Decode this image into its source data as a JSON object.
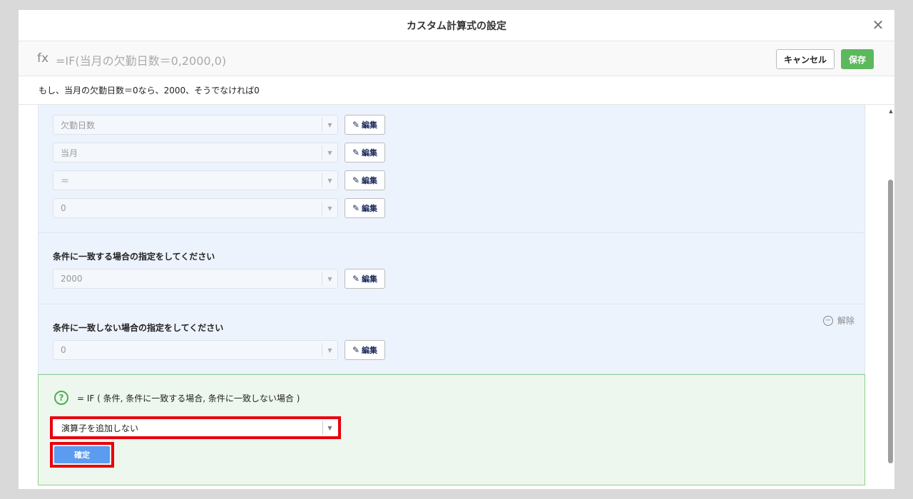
{
  "modal": {
    "title": "カスタム計算式の設定",
    "close_icon": "close-icon"
  },
  "formula_bar": {
    "fx": "fx",
    "formula": "=IF(当月の欠勤日数＝0,2000,0)",
    "cancel_label": "キャンセル",
    "save_label": "保存"
  },
  "description": "もし、当月の欠勤日数＝0なら、2000、そうでなければ0",
  "condition": {
    "rows": [
      {
        "value": "欠勤日数",
        "edit_label": "編集"
      },
      {
        "value": "当月",
        "edit_label": "編集"
      },
      {
        "value": "＝",
        "edit_label": "編集"
      },
      {
        "value": "0",
        "edit_label": "編集"
      }
    ]
  },
  "match": {
    "label": "条件に一致する場合の指定をしてください",
    "value": "2000",
    "edit_label": "編集"
  },
  "nomatch": {
    "label": "条件に一致しない場合の指定をしてください",
    "value": "0",
    "edit_label": "編集",
    "release_label": "解除"
  },
  "help": {
    "syntax": "= IF ( 条件, 条件に一致する場合, 条件に一致しない場合 )",
    "operator_selected": "演算子を追加しない",
    "confirm_label": "確定"
  },
  "colors": {
    "accent_green": "#5cb85c",
    "confirm_blue": "#5b9bf0",
    "highlight_red": "#e8000b",
    "panel_blue": "#edf3fd",
    "panel_green": "#eef7ee"
  }
}
